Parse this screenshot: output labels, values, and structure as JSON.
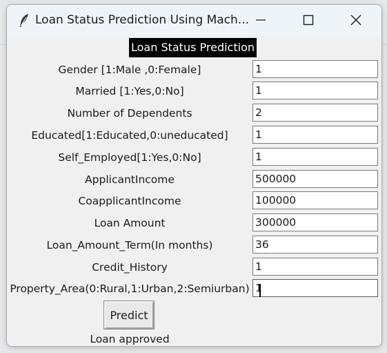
{
  "window": {
    "title": "Loan Status Prediction Using Mach...",
    "controls": [
      "minimize-icon",
      "maximize-icon",
      "close-icon"
    ],
    "app_icon": "feather-icon"
  },
  "form": {
    "heading": "Loan Status Prediction",
    "fields": [
      {
        "label": "Gender [1:Male ,0:Female]",
        "value": "1"
      },
      {
        "label": "Married [1:Yes,0:No]",
        "value": "1"
      },
      {
        "label": "Number of Dependents",
        "value": "2"
      },
      {
        "label": "Educated[1:Educated,0:uneducated]",
        "value": "1"
      },
      {
        "label": "Self_Employed[1:Yes,0:No]",
        "value": "1"
      },
      {
        "label": "ApplicantIncome",
        "value": "500000"
      },
      {
        "label": "CoapplicantIncome",
        "value": "100000"
      },
      {
        "label": "Loan Amount",
        "value": "300000"
      },
      {
        "label": "Loan_Amount_Term(In months)",
        "value": "36"
      },
      {
        "label": "Credit_History",
        "value": "1"
      },
      {
        "label": "Property_Area(0:Rural,1:Urban,2:Semiurban)",
        "value": "1"
      }
    ],
    "predict_label": "Predict",
    "result": "Loan approved"
  },
  "colors": {
    "heading_bg": "#000000",
    "heading_fg": "#ffffff",
    "window_bg": "#f0f0f0",
    "titlebar_bg": "#eff4f9"
  }
}
